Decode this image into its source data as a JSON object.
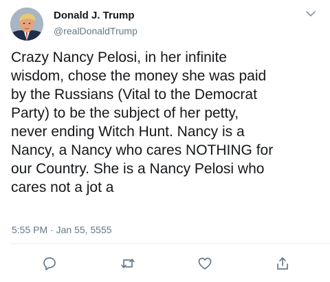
{
  "tweet": {
    "author": {
      "display_name": "Donald J. Trump",
      "handle": "@realDonaldTrump"
    },
    "text_lines": [
      "Crazy Nancy Pelosi, in her infinite",
      "wisdom, chose the money she was paid",
      "by the Russians (Vital to the Democrat",
      "Party) to be the subject of her petty,",
      "never ending Witch Hunt. Nancy is a",
      "Nancy, a Nancy who cares NOTHING for",
      "our Country. She is a Nancy Pelosi who",
      "cares not a jot a"
    ],
    "timestamp": "5:55 PM · Jan 55, 5555",
    "actions": {
      "reply_icon": "speech-bubble",
      "retweet_icon": "retweet-arrows",
      "like_icon": "heart",
      "share_icon": "upload-arrow"
    },
    "colors": {
      "text": "#14171a",
      "secondary": "#657786",
      "divider": "#e6ecf0"
    }
  }
}
